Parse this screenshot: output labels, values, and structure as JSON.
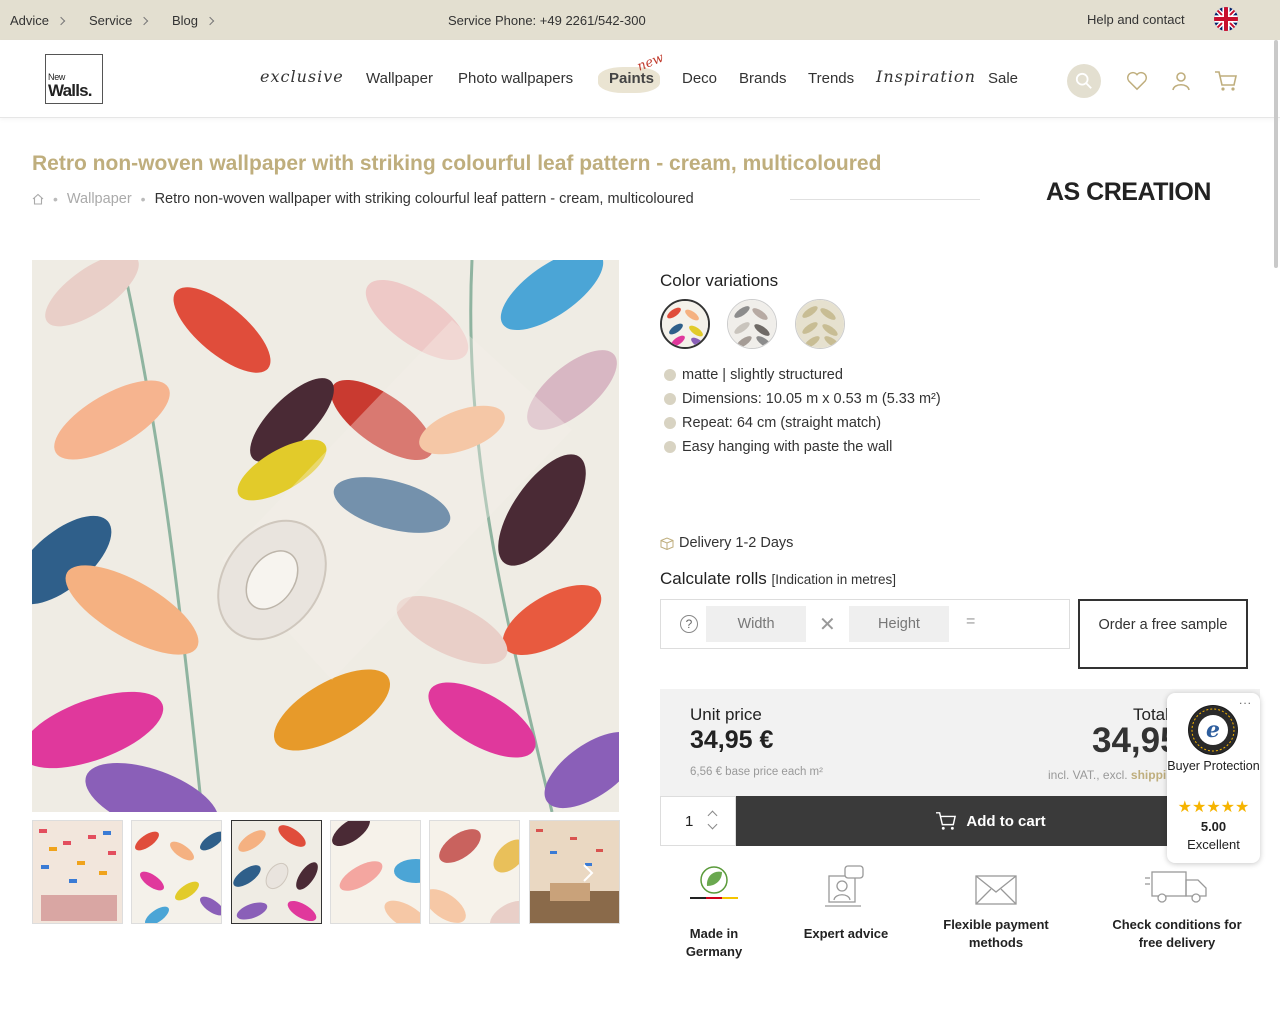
{
  "topbar": {
    "links": [
      "Advice",
      "Service",
      "Blog"
    ],
    "phone": "Service Phone: +49 2261/542-300",
    "help": "Help and contact"
  },
  "header": {
    "logo_line1": "New",
    "logo_line2": "Walls.",
    "nav": [
      "exclusive",
      "Wallpaper",
      "Photo wallpapers",
      "Paints",
      "Deco",
      "Brands",
      "Trends",
      "Inspiration",
      "Sale"
    ],
    "new_tag": "new"
  },
  "product": {
    "title": "Retro non-woven wallpaper with striking colourful leaf pattern - cream, multicoloured",
    "breadcrumb": [
      "Wallpaper",
      "Retro non-woven wallpaper with striking colourful leaf pattern - cream, multicoloured"
    ],
    "brand": "AS CREATION",
    "color_variations_title": "Color variations",
    "features": [
      "matte | slightly structured",
      "Dimensions: 10.05 m x 0.53 m (5.33 m²)",
      "Repeat: 64 cm (straight match)",
      "Easy hanging with paste the wall"
    ],
    "delivery": "Delivery 1-2 Days"
  },
  "calculator": {
    "title": "Calculate rolls",
    "subtitle": "[Indication in metres]",
    "help": "?",
    "width_placeholder": "Width",
    "height_placeholder": "Height",
    "equals": "=",
    "sample_button": "Order a free sample"
  },
  "pricing": {
    "unit_label": "Unit price",
    "unit_price": "34,95 €",
    "base_price": "6,56 € base price each m²",
    "total_label": "Total",
    "total_price": "34,95 €",
    "vat_prefix": "incl. VAT., excl.",
    "vat_shipping": "shipping"
  },
  "cart": {
    "quantity": "1",
    "add_label": "Add to cart"
  },
  "usps": [
    "Made in Germany",
    "Expert advice",
    "Flexible payment methods",
    "Check conditions for free delivery"
  ],
  "trusted_shops": {
    "label": "Buyer Protection",
    "stars": "★★★★★",
    "rating": "5.00",
    "verdict": "Excellent",
    "more": "..."
  },
  "colors": {
    "accent": "#bfae7d",
    "topbar_bg": "#e3dfd0",
    "dark_button": "#3a3a3a",
    "star": "#f6b400"
  }
}
